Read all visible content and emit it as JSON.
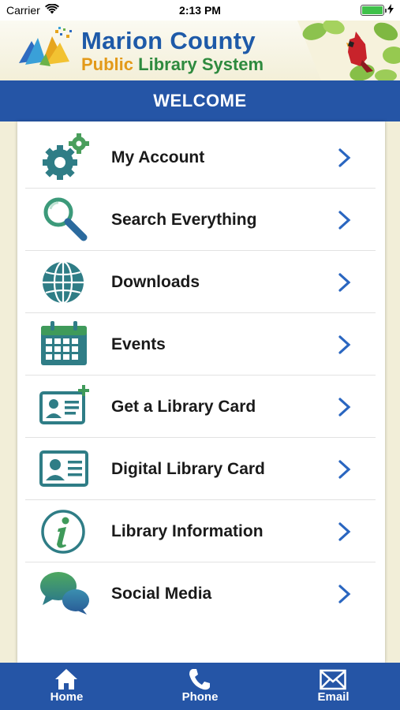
{
  "status_bar": {
    "carrier": "Carrier",
    "time": "2:13 PM"
  },
  "header": {
    "brand_line1": "Marion County",
    "brand_line2_part1": "Public",
    "brand_line2_part2": "Library System"
  },
  "welcome": {
    "title": "WELCOME"
  },
  "menu": {
    "items": [
      {
        "label": "My Account",
        "icon": "gears-icon"
      },
      {
        "label": "Search Everything",
        "icon": "magnifier-icon"
      },
      {
        "label": "Downloads",
        "icon": "globe-icon"
      },
      {
        "label": "Events",
        "icon": "calendar-icon"
      },
      {
        "label": "Get a Library Card",
        "icon": "add-card-icon"
      },
      {
        "label": "Digital Library Card",
        "icon": "id-card-icon"
      },
      {
        "label": "Library Information",
        "icon": "info-icon"
      },
      {
        "label": "Social Media",
        "icon": "chat-bubbles-icon"
      }
    ]
  },
  "tab_bar": {
    "tabs": [
      {
        "label": "Home",
        "icon": "home-icon"
      },
      {
        "label": "Phone",
        "icon": "phone-icon"
      },
      {
        "label": "Email",
        "icon": "envelope-icon"
      }
    ]
  },
  "colors": {
    "primary_blue": "#2555a6",
    "icon_teal": "#2f7d86",
    "chevron_blue": "#2a66c0",
    "banner_bg": "#f3efd8"
  }
}
